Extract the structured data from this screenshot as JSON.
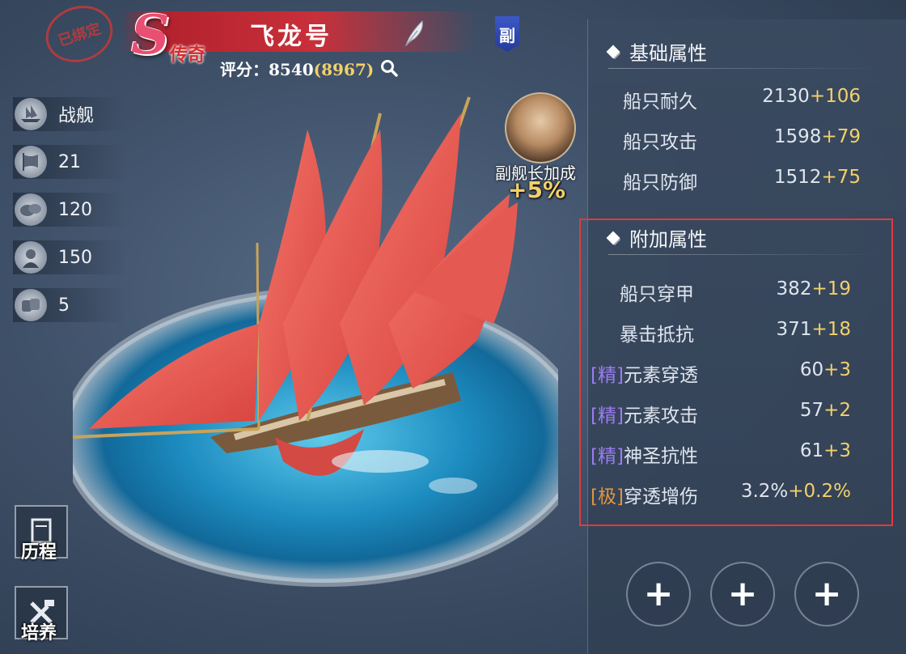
{
  "header": {
    "bound_stamp": "已绑定",
    "grade": "S",
    "rarity": "传奇",
    "ship_name": "飞龙号",
    "vice_badge": "副",
    "score_label": "评分：",
    "score_value": "8540",
    "score_max": "(8967)"
  },
  "stats": [
    {
      "icon": "warship-icon",
      "value": "战舰"
    },
    {
      "icon": "sail-icon",
      "value": "21"
    },
    {
      "icon": "supplies-icon",
      "value": "120"
    },
    {
      "icon": "sailor-icon",
      "value": "150"
    },
    {
      "icon": "cannon-icon",
      "value": "5"
    }
  ],
  "side_buttons": {
    "history": "历程",
    "train": "培养"
  },
  "vice_captain": {
    "label": "副舰长加成",
    "bonus": "+5%"
  },
  "basic_attrs": {
    "title": "基础属性",
    "rows": [
      {
        "name": "船只耐久",
        "base": "2130",
        "add": "+106"
      },
      {
        "name": "船只攻击",
        "base": "1598",
        "add": "+79"
      },
      {
        "name": "船只防御",
        "base": "1512",
        "add": "+75"
      }
    ]
  },
  "extra_attrs": {
    "title": "附加属性",
    "rows": [
      {
        "tag": "",
        "name": "船只穿甲",
        "base": "382",
        "add": "+19"
      },
      {
        "tag": "",
        "name": "暴击抵抗",
        "base": "371",
        "add": "+18"
      },
      {
        "tag": "[精]",
        "name": "元素穿透",
        "base": "60",
        "add": "+3"
      },
      {
        "tag": "[精]",
        "name": "元素攻击",
        "base": "57",
        "add": "+2"
      },
      {
        "tag": "[精]",
        "name": "神圣抗性",
        "base": "61",
        "add": "+3"
      },
      {
        "tag": "[极]",
        "name": "穿透增伤",
        "base": "3.2%",
        "add": "+0.2%"
      }
    ]
  },
  "slots": [
    "+",
    "+",
    "+"
  ],
  "colors": {
    "accent_gold": "#f2d06b",
    "banner_red": "#c8303a",
    "highlight_box": "#e23a3a",
    "tag_jing": "#9b7cf0",
    "tag_ji": "#e0943f"
  }
}
